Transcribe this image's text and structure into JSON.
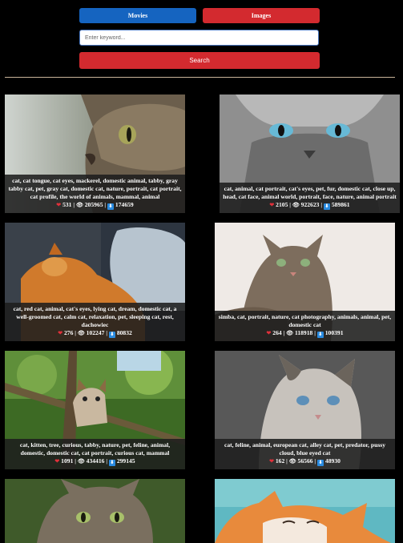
{
  "nav": {
    "movies_label": "Movies",
    "images_label": "Images"
  },
  "search": {
    "placeholder": "Enter keyword...",
    "button_label": "Search"
  },
  "colors": {
    "movies_button": "#1564c0",
    "images_button": "#d32a2f",
    "search_button": "#d32a2f",
    "background": "#000000"
  },
  "results": [
    {
      "tags": "cat, cat tongue, cat eyes, mackerel, domestic animal, tabby, gray tabby cat, pet, gray cat, domestic cat, nature, portrait, cat portrait, cat profile, the world of animals, mammal, animal",
      "likes": "531",
      "views": "205965",
      "downloads": "174659"
    },
    {
      "tags": "cat, animal, cat portrait, cat's eyes, pet, fur, domestic cat, close up, head, cat face, animal world, portrait, face, nature, animal portrait",
      "likes": "2105",
      "views": "922623",
      "downloads": "589861"
    },
    {
      "tags": "cat, red cat, animal, cat's eyes, lying cat, dream, domestic cat, a well-groomed cat, calm cat, relaxation, pet, sleeping cat, rest, dachowiec",
      "likes": "276",
      "views": "102247",
      "downloads": "80832"
    },
    {
      "tags": "simba, cat, portrait, nature, cat photography, animals, animal, pet, domestic cat",
      "likes": "264",
      "views": "118918",
      "downloads": "100391"
    },
    {
      "tags": "cat, kitten, tree, curious, tabby, nature, pet, feline, animal, domestic, domestic cat, cat portrait, curious cat, mammal",
      "likes": "1091",
      "views": "434416",
      "downloads": "299145"
    },
    {
      "tags": "cat, feline, animal, european cat, alley cat, pet, predator, pussy cloud, blue eyed cat",
      "likes": "162",
      "views": "56566",
      "downloads": "48930"
    },
    {
      "tags": "",
      "likes": "",
      "views": "",
      "downloads": ""
    },
    {
      "tags": "",
      "likes": "",
      "views": "",
      "downloads": ""
    }
  ]
}
